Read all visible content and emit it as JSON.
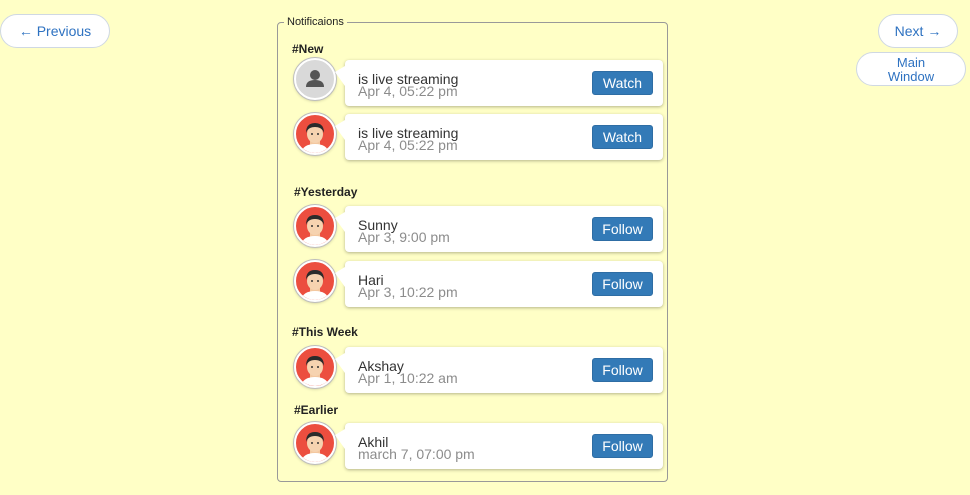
{
  "nav": {
    "previous_label": "← Previous",
    "next_label": "Next →",
    "main_window_line1": "Main",
    "main_window_line2": "Window"
  },
  "panel": {
    "legend": "Notificaions"
  },
  "sections": {
    "new": "#New",
    "yesterday": "#Yesterday",
    "this_week": "#This Week",
    "earlier": "#Earlier"
  },
  "notifications": [
    {
      "avatar": "default-user-icon",
      "title": "is live streaming",
      "time": "Apr 4, 05:22 pm",
      "action": "Watch"
    },
    {
      "avatar": "boy-avatar-icon",
      "title": "is live streaming",
      "time": "Apr 4, 05:22 pm",
      "action": "Watch"
    },
    {
      "avatar": "boy-avatar-icon",
      "title": "Sunny",
      "time": "Apr 3, 9:00 pm",
      "action": "Follow"
    },
    {
      "avatar": "boy-avatar-icon",
      "title": "Hari",
      "time": "Apr 3, 10:22 pm",
      "action": "Follow"
    },
    {
      "avatar": "boy-avatar-icon",
      "title": "Akshay",
      "time": "Apr 1, 10:22 am",
      "action": "Follow"
    },
    {
      "avatar": "boy-avatar-icon",
      "title": "Akhil",
      "time": "march 7, 07:00 pm",
      "action": "Follow"
    }
  ],
  "colors": {
    "background": "#ffffc6",
    "button_primary": "#337ab7",
    "link_text": "#2e72c1",
    "avatar_red": "#ec4e3f"
  }
}
